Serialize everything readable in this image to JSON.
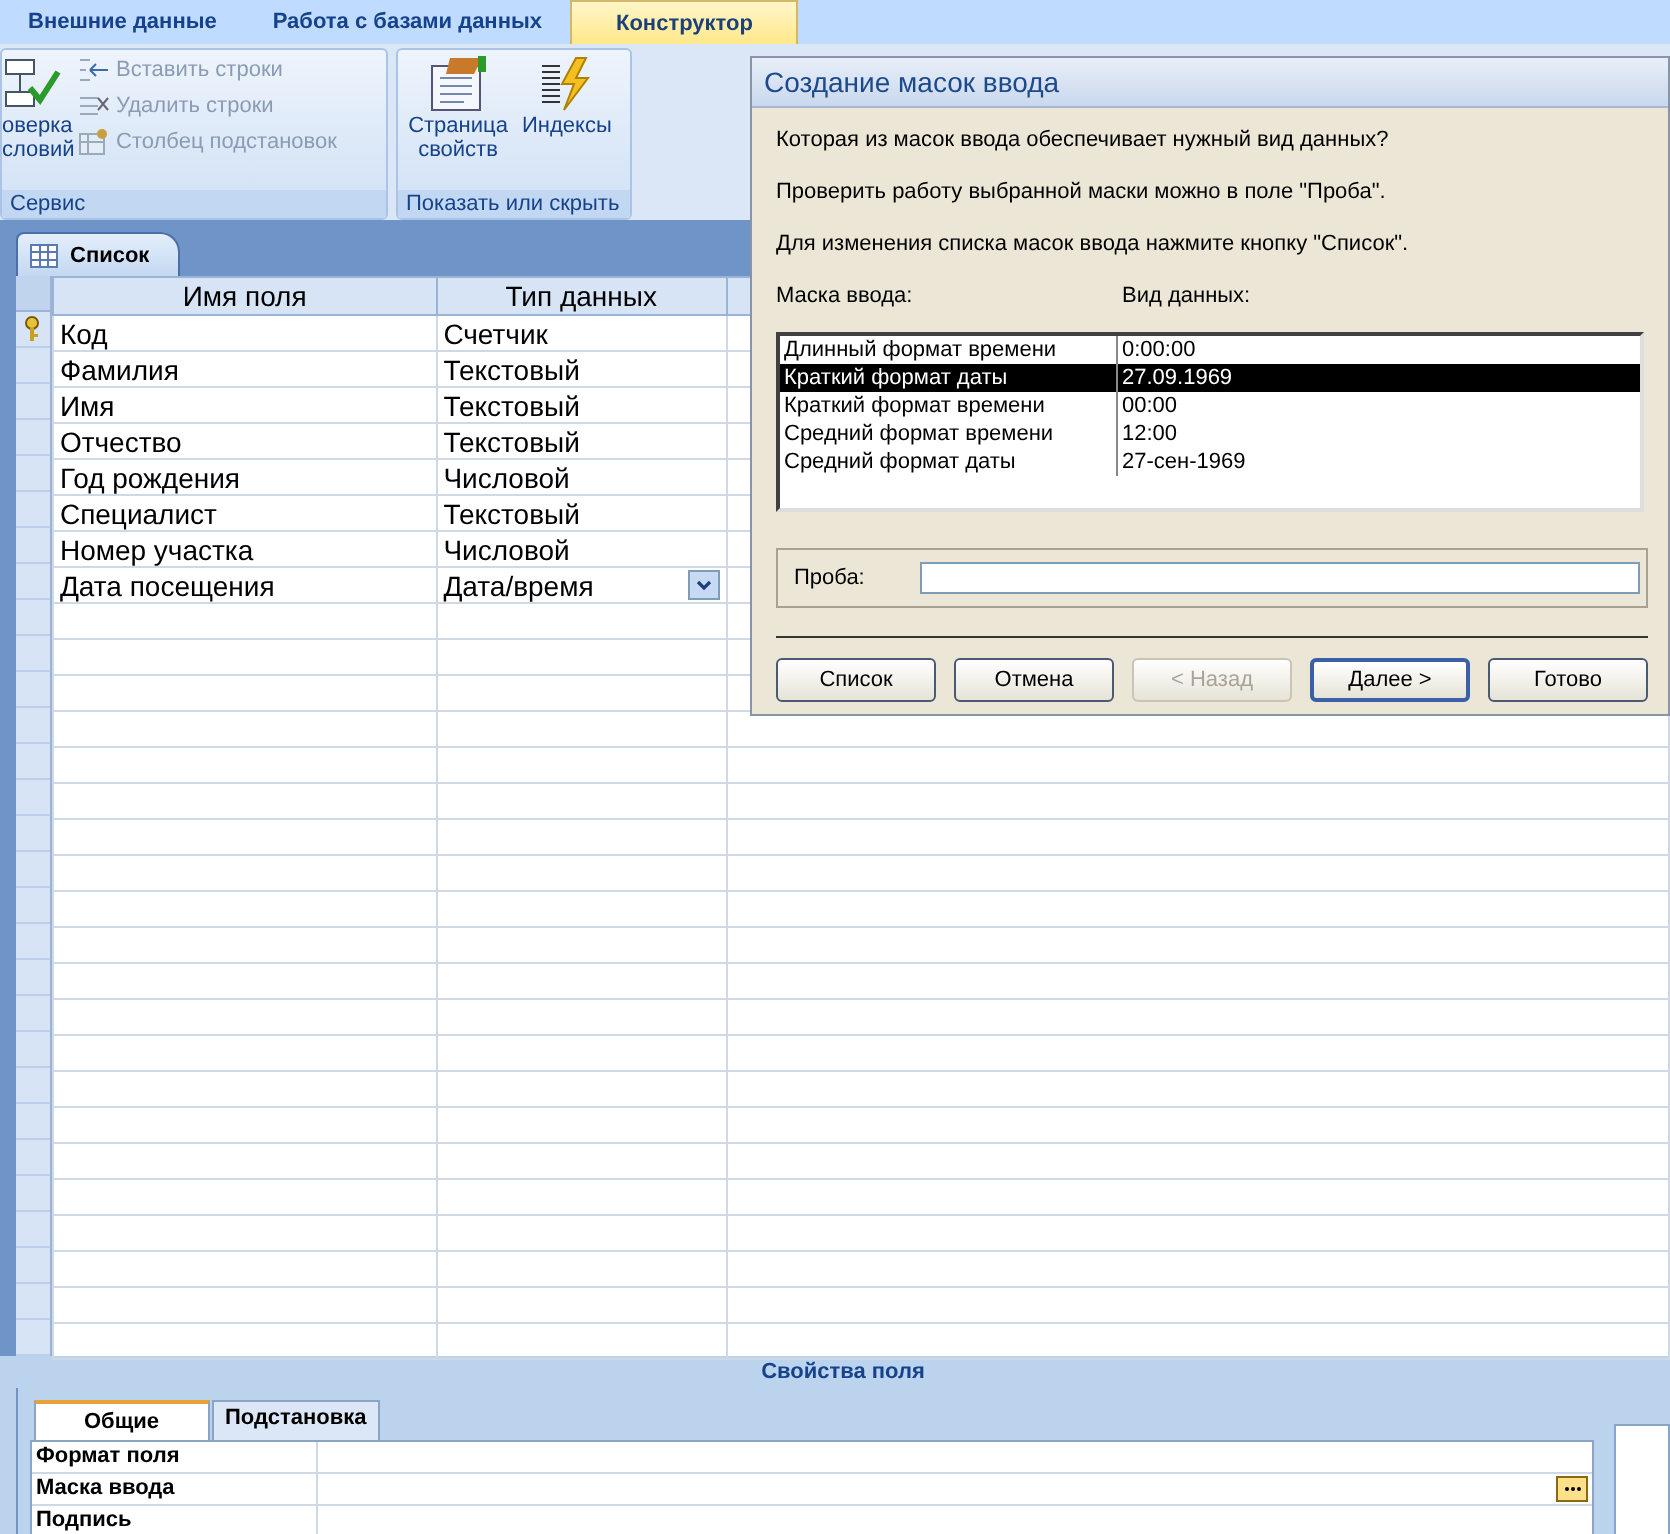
{
  "ribbon": {
    "tabs": [
      {
        "label": "Внешние данные",
        "selected": false
      },
      {
        "label": "Работа с базами данных",
        "selected": false
      },
      {
        "label": "Конструктор",
        "selected": true
      }
    ],
    "groups": [
      {
        "label": "Сервис",
        "items": [
          {
            "kind": "large",
            "label": "оверка словий"
          },
          {
            "kind": "small",
            "label": "Вставить строки"
          },
          {
            "kind": "small",
            "label": "Удалить строки"
          },
          {
            "kind": "small",
            "label": "Столбец  подстановок"
          }
        ]
      },
      {
        "label": "Показать или скрыть",
        "items": [
          {
            "kind": "large",
            "label": "Страница свойств"
          },
          {
            "kind": "large",
            "label": "Индексы"
          }
        ]
      }
    ]
  },
  "document_tab": {
    "label": "Список",
    "selected": true
  },
  "table": {
    "columns": [
      "Имя поля",
      "Тип данных"
    ],
    "rows": [
      {
        "field": "Код",
        "type": "Счетчик",
        "primary_key": true,
        "current": false
      },
      {
        "field": "Фамилия",
        "type": "Текстовый",
        "primary_key": false,
        "current": false
      },
      {
        "field": "Имя",
        "type": "Текстовый",
        "primary_key": false,
        "current": false
      },
      {
        "field": "Отчество",
        "type": "Текстовый",
        "primary_key": false,
        "current": false
      },
      {
        "field": "Год рождения",
        "type": "Числовой",
        "primary_key": false,
        "current": false
      },
      {
        "field": "Специалист",
        "type": "Текстовый",
        "primary_key": false,
        "current": false
      },
      {
        "field": "Номер участка",
        "type": "Числовой",
        "primary_key": false,
        "current": false
      },
      {
        "field": "Дата посещения",
        "type": "Дата/время",
        "primary_key": false,
        "current": true
      }
    ]
  },
  "field_properties": {
    "title": "Свойства поля",
    "tabs": [
      {
        "label": "Общие",
        "selected": true
      },
      {
        "label": "Подстановка",
        "selected": false
      }
    ],
    "rows": [
      {
        "label": "Формат поля",
        "builder": false
      },
      {
        "label": "Маска ввода",
        "builder": true
      },
      {
        "label": "Подпись",
        "builder": false
      }
    ]
  },
  "dialog": {
    "title": "Создание масок ввода",
    "prompts": [
      "Которая из масок ввода обеспечивает нужный вид данных?",
      "Проверить работу выбранной маски можно в поле \"Проба\".",
      "Для изменения списка масок ввода нажмите кнопку \"Список\"."
    ],
    "list_headers": [
      "Маска ввода:",
      "Вид данных:"
    ],
    "options": [
      {
        "mask": "Длинный формат времени",
        "sample": "0:00:00",
        "selected": false
      },
      {
        "mask": "Краткий формат даты",
        "sample": "27.09.1969",
        "selected": true
      },
      {
        "mask": "Краткий формат времени",
        "sample": "00:00",
        "selected": false
      },
      {
        "mask": "Средний формат времени",
        "sample": "12:00",
        "selected": false
      },
      {
        "mask": "Средний формат даты",
        "sample": "27-сен-1969",
        "selected": false
      }
    ],
    "test_label": "Проба:",
    "buttons": [
      {
        "label": "Список",
        "disabled": false,
        "default": false
      },
      {
        "label": "Отмена",
        "disabled": false,
        "default": false
      },
      {
        "label": "< Назад",
        "disabled": true,
        "default": false
      },
      {
        "label": "Далее >",
        "disabled": false,
        "default": true
      },
      {
        "label": "Готово",
        "disabled": false,
        "default": false
      }
    ]
  }
}
